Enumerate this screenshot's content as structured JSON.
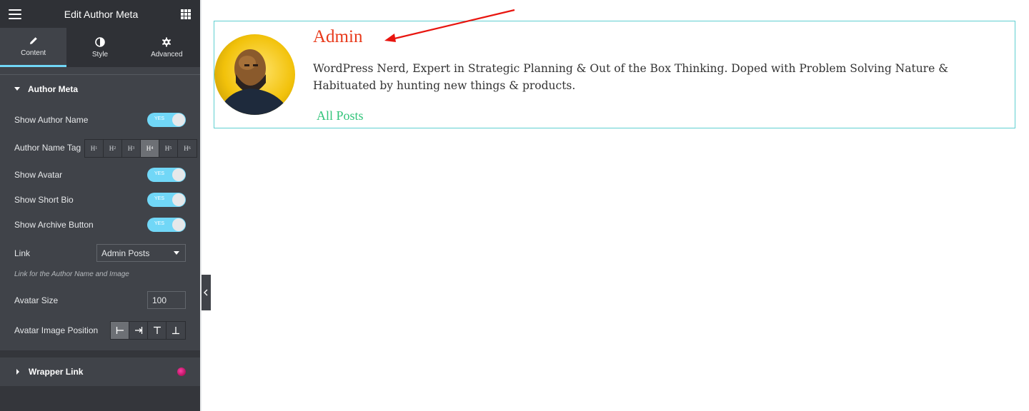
{
  "panel": {
    "title": "Edit Author Meta",
    "tabs": [
      {
        "label": "Content",
        "icon": "pencil-icon"
      },
      {
        "label": "Style",
        "icon": "half-circle-icon"
      },
      {
        "label": "Advanced",
        "icon": "gear-icon"
      }
    ],
    "section": {
      "title": "Author Meta"
    },
    "controls": {
      "show_author_name": {
        "label": "Show Author Name",
        "toggle": "YES"
      },
      "author_name_tag": {
        "label": "Author Name Tag",
        "options": [
          "H1",
          "H2",
          "H3",
          "H4",
          "H5",
          "H6"
        ],
        "selected": "H4"
      },
      "show_avatar": {
        "label": "Show Avatar",
        "toggle": "YES"
      },
      "show_short_bio": {
        "label": "Show Short Bio",
        "toggle": "YES"
      },
      "show_archive_button": {
        "label": "Show Archive Button",
        "toggle": "YES"
      },
      "link": {
        "label": "Link",
        "value": "Admin Posts",
        "description": "Link for the Author Name and Image"
      },
      "avatar_size": {
        "label": "Avatar Size",
        "value": "100"
      },
      "avatar_image_position": {
        "label": "Avatar Image Position",
        "options": [
          "left",
          "right",
          "top",
          "bottom"
        ],
        "selected": "left"
      }
    },
    "wrapper_section": {
      "title": "Wrapper Link"
    }
  },
  "preview": {
    "author_name": "Admin",
    "bio": "WordPress Nerd, Expert in Strategic Planning & Out of the Box Thinking. Doped with Problem Solving Nature & Habituated by hunting new things & products.",
    "archive_link": "All Posts"
  },
  "colors": {
    "accent": "#71d7f7",
    "author_name": "#e8391a",
    "archive_link": "#32c47a",
    "box_border": "#5fcfd1",
    "annotation_arrow": "#e8150f"
  }
}
